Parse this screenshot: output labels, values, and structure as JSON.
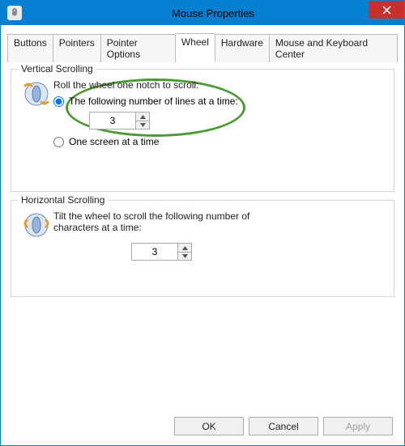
{
  "window": {
    "title": "Mouse Properties"
  },
  "tabs": {
    "items": [
      "Buttons",
      "Pointers",
      "Pointer Options",
      "Wheel",
      "Hardware",
      "Mouse and Keyboard Center"
    ],
    "active_index": 3
  },
  "vertical": {
    "group_label": "Vertical Scrolling",
    "instruction": "Roll the wheel one notch to scroll:",
    "radio_lines_label": "The following number of lines at a time:",
    "radio_screen_label": "One screen at a time",
    "lines_value": "3",
    "selected": "lines"
  },
  "horizontal": {
    "group_label": "Horizontal Scrolling",
    "instruction": "Tilt the wheel to scroll the following number of characters at a time:",
    "chars_value": "3"
  },
  "buttons": {
    "ok": "OK",
    "cancel": "Cancel",
    "apply": "Apply"
  }
}
